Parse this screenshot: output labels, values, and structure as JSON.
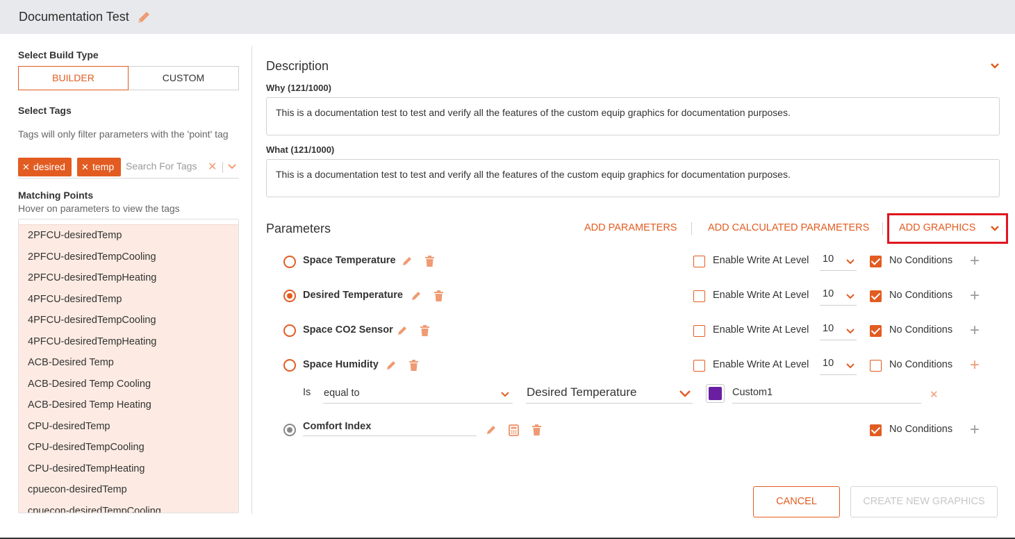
{
  "header": {
    "title": "Documentation Test",
    "edit_icon": "pencil-icon"
  },
  "left": {
    "build_type_label": "Select Build Type",
    "build_types": [
      "BUILDER",
      "CUSTOM"
    ],
    "select_tags_label": "Select Tags",
    "tags_hint": "Tags will only filter parameters with the 'point' tag",
    "tags": [
      "desired",
      "temp"
    ],
    "tag_search_placeholder": "Search For Tags",
    "matching_points_label": "Matching Points",
    "matching_points_hint": "Hover on parameters to view the tags",
    "points": [
      "2PFCU-desiredTemp",
      "2PFCU-desiredTempCooling",
      "2PFCU-desiredTempHeating",
      "4PFCU-desiredTemp",
      "4PFCU-desiredTempCooling",
      "4PFCU-desiredTempHeating",
      "ACB-Desired Temp",
      "ACB-Desired Temp Cooling",
      "ACB-Desired Temp Heating",
      "CPU-desiredTemp",
      "CPU-desiredTempCooling",
      "CPU-desiredTempHeating",
      "cpuecon-desiredTemp",
      "cpuecon-desiredTempCooling"
    ]
  },
  "description": {
    "title": "Description",
    "why_label": "Why (121/1000)",
    "why_text": "This is a documentation test to test and verify all the features of the custom equip graphics for documentation purposes.",
    "what_label": "What (121/1000)",
    "what_text": "This is a documentation test to test and verify all the features of the custom equip graphics for documentation purposes."
  },
  "parameters": {
    "title": "Parameters",
    "add_parameters": "ADD PARAMETERS",
    "add_calculated": "ADD CALCULATED PARAMETERS",
    "add_graphics": "ADD GRAPHICS",
    "enable_write_label": "Enable Write At Level",
    "no_conditions_label": "No Conditions",
    "rows": [
      {
        "name": "Space Temperature",
        "level": "10"
      },
      {
        "name": "Desired Temperature",
        "level": "10"
      },
      {
        "name": "Space CO2 Sensor",
        "level": "10"
      },
      {
        "name": "Space Humidity",
        "level": "10"
      }
    ],
    "condition": {
      "is_label": "Is",
      "operator": "equal to",
      "target": "Desired Temperature",
      "color": "#6a1fa3",
      "value": "Custom1"
    },
    "calculated": {
      "name": "Comfort Index"
    }
  },
  "actions": {
    "cancel": "CANCEL",
    "create": "CREATE NEW GRAPHICS"
  },
  "colors": {
    "accent": "#e25c21",
    "accent_light": "#fdebe3",
    "highlight": "#e0141f"
  }
}
